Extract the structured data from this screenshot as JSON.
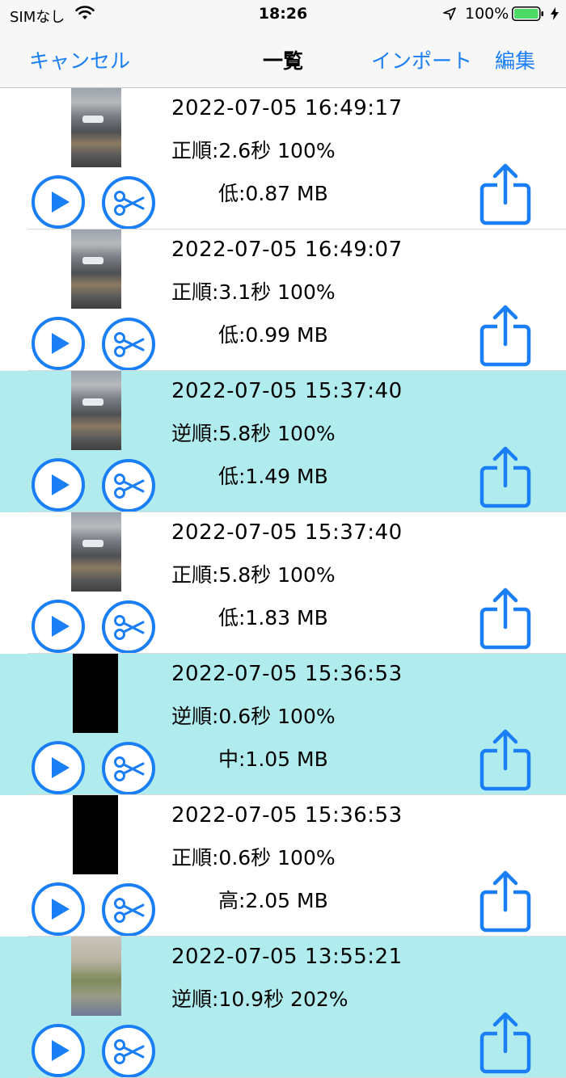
{
  "status_bar": {
    "carrier": "SIMなし",
    "time": "18:26",
    "battery_percent": "100%",
    "battery_color": "#4cd964"
  },
  "nav": {
    "cancel_label": "キャンセル",
    "title": "一覧",
    "import_label": "インポート",
    "edit_label": "編集"
  },
  "colors": {
    "accent": "#1a7ff6",
    "reverse_row_bg": "#b0ecee"
  },
  "items": [
    {
      "date": "2022-07-05 16:49:17",
      "info": "正順:2.6秒 100%",
      "size": "低:0.87 MB",
      "reverse": false,
      "thumb": "street"
    },
    {
      "date": "2022-07-05 16:49:07",
      "info": "正順:3.1秒 100%",
      "size": "低:0.99 MB",
      "reverse": false,
      "thumb": "street"
    },
    {
      "date": "2022-07-05 15:37:40",
      "info": "逆順:5.8秒 100%",
      "size": "低:1.49 MB",
      "reverse": true,
      "thumb": "street"
    },
    {
      "date": "2022-07-05 15:37:40",
      "info": "正順:5.8秒 100%",
      "size": "低:1.83 MB",
      "reverse": false,
      "thumb": "street"
    },
    {
      "date": "2022-07-05 15:36:53",
      "info": "逆順:0.6秒 100%",
      "size": "中:1.05 MB",
      "reverse": true,
      "thumb": "black"
    },
    {
      "date": "2022-07-05 15:36:53",
      "info": "正順:0.6秒 100%",
      "size": "高:2.05 MB",
      "reverse": false,
      "thumb": "black"
    },
    {
      "date": "2022-07-05 13:55:21",
      "info": "逆順:10.9秒 202%",
      "size": "",
      "reverse": true,
      "thumb": "park"
    }
  ]
}
